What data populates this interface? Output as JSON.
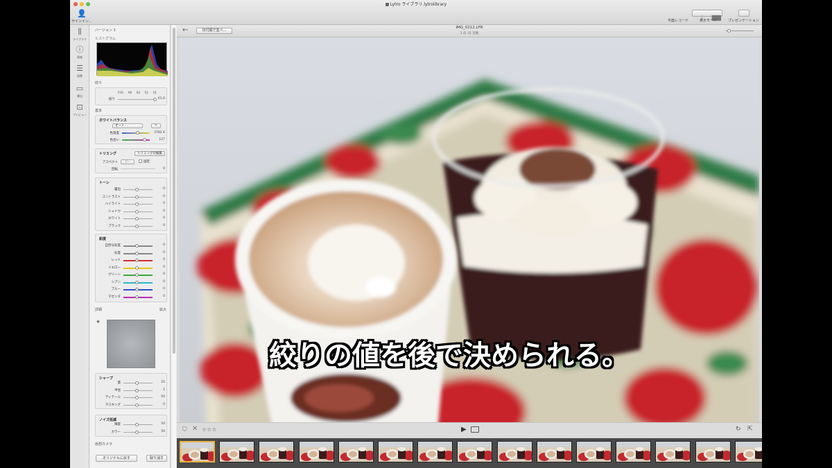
{
  "app": {
    "window_title": "Lytro ライブラリ.lytrolibrary",
    "user_label": "サインイン...",
    "toolbar": {
      "flat_view_label": "平面レコード",
      "display_mode_label": "表示モード",
      "presentation_label": "プレゼンテーション"
    }
  },
  "leftbar": {
    "items": [
      {
        "icon": "library-icon",
        "glyph": "|||\\",
        "label": "ライブラリ"
      },
      {
        "icon": "info-icon",
        "glyph": "ⓘ",
        "label": "情報"
      },
      {
        "icon": "adjust-icon",
        "glyph": "☰",
        "label": "調整"
      },
      {
        "icon": "export-icon",
        "glyph": "▭",
        "label": "書出"
      },
      {
        "icon": "preview-icon",
        "glyph": "⊡",
        "label": "プレビュー"
      }
    ]
  },
  "panel": {
    "version_label": "バージョン 3",
    "histogram_label": "ヒストグラム",
    "aperture": {
      "section_label": "絞り",
      "scale": [
        "f/16",
        "f/8",
        "f/4",
        "f/2",
        "f/1"
      ],
      "row_label": "絞り",
      "value": "f/1.0",
      "level": 0.92
    },
    "basic_label": "基本",
    "white_balance": {
      "title": "ホワイトバランス",
      "preset": "オート",
      "temperature_label": "色温度",
      "temperature_value": "3782 K",
      "tint_label": "色合い",
      "tint_value": "127"
    },
    "crop": {
      "title": "トリミング",
      "edit_button": "トリミングの編集",
      "aspect_label": "アスペクト",
      "aspect_select": "カー",
      "lock_label": "固定",
      "rotate_label": "回転",
      "rotate_value": "0"
    },
    "tone": {
      "title": "トーン",
      "rows": [
        {
          "label": "露出",
          "value": "0"
        },
        {
          "label": "コントラスト",
          "value": "0"
        },
        {
          "label": "ハイライト",
          "value": "0"
        },
        {
          "label": "シャドウ",
          "value": "0"
        },
        {
          "label": "ホワイト",
          "value": "0"
        },
        {
          "label": "ブラック",
          "value": "0"
        }
      ]
    },
    "saturation": {
      "title": "彩度",
      "rows": [
        {
          "label": "自然な彩度",
          "value": "0",
          "color": "#888888"
        },
        {
          "label": "彩度",
          "value": "0",
          "color": "#888888"
        },
        {
          "label": "レッド",
          "value": "0",
          "color": "#d62b2b"
        },
        {
          "label": "イエロー",
          "value": "0",
          "color": "#e6c619"
        },
        {
          "label": "グリーン",
          "value": "0",
          "color": "#3aa83a"
        },
        {
          "label": "シアン",
          "value": "0",
          "color": "#28b7c9"
        },
        {
          "label": "ブルー",
          "value": "0",
          "color": "#2a4fcf"
        },
        {
          "label": "マゼンタ",
          "value": "0",
          "color": "#c02ab8"
        }
      ]
    },
    "detail_label": "詳細",
    "detail_zoom": "拡大",
    "sharpen": {
      "title": "シャープ",
      "rows": [
        {
          "label": "量",
          "value": "25"
        },
        {
          "label": "半径",
          "value": "1"
        },
        {
          "label": "ディテール",
          "value": "50"
        },
        {
          "label": "マスキング",
          "value": "0"
        }
      ]
    },
    "noise": {
      "title": "ノイズ低減",
      "rows": [
        {
          "label": "輝度",
          "value": "50"
        },
        {
          "label": "カラー",
          "value": "50"
        }
      ]
    },
    "virtual_camera_label": "仮想カメラ",
    "reset_button": "オリジナルに戻す",
    "undo_button": "取り消す"
  },
  "main": {
    "sort_select": "日付順で並べ...",
    "file_name": "IMG_0212.LFR",
    "count_text": "1 の 35 写真",
    "rating_stars": "☆☆☆",
    "subtitle": "絞りの値を後で決められる。",
    "thumb_count": 15
  }
}
